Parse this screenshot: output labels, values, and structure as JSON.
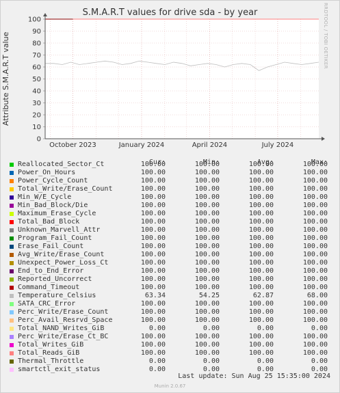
{
  "chart_data": {
    "type": "line",
    "title": "S.M.A.R.T values for drive sda - by year",
    "ylabel": "Attribute S.M.A.R.T value",
    "ylim": [
      0,
      100
    ],
    "yticks": [
      0,
      10,
      20,
      30,
      40,
      50,
      60,
      70,
      80,
      90,
      100
    ],
    "xlim": [
      "2023-08-25",
      "2024-08-25"
    ],
    "xticks": [
      {
        "label": "October 2023",
        "date": "2023-10-01"
      },
      {
        "label": "January 2024",
        "date": "2024-01-01"
      },
      {
        "label": "April 2024",
        "date": "2024-04-01"
      },
      {
        "label": "July 2024",
        "date": "2024-07-01"
      }
    ],
    "grid": true,
    "series": [
      {
        "name": "Reallocated_Sector_Ct",
        "color": "#00cc00",
        "values": [
          100,
          100
        ]
      },
      {
        "name": "Power_On_Hours",
        "color": "#0066b3",
        "values": [
          100,
          100
        ]
      },
      {
        "name": "Power_Cycle_Count",
        "color": "#ff8000",
        "values": [
          100,
          100
        ]
      },
      {
        "name": "Total_Write/Erase_Count",
        "color": "#ffcc00",
        "values": [
          100,
          100
        ]
      },
      {
        "name": "Min_W/E_Cycle",
        "color": "#330099",
        "values": [
          100,
          100
        ]
      },
      {
        "name": "Min_Bad_Block/Die",
        "color": "#990099",
        "values": [
          100,
          100
        ]
      },
      {
        "name": "Maximum_Erase_Cycle",
        "color": "#ccff00",
        "values": [
          100,
          100
        ]
      },
      {
        "name": "Total_Bad_Block",
        "color": "#ff0000",
        "values": [
          100,
          100
        ]
      },
      {
        "name": "Unknown_Marvell_Attr",
        "color": "#808080",
        "values": [
          100,
          100
        ]
      },
      {
        "name": "Program_Fail_Count",
        "color": "#008f00",
        "values": [
          100,
          100
        ]
      },
      {
        "name": "Erase_Fail_Count",
        "color": "#00487d",
        "values": [
          100,
          100
        ]
      },
      {
        "name": "Avg_Write/Erase_Count",
        "color": "#b35a00",
        "values": [
          100,
          100
        ]
      },
      {
        "name": "Unexpect_Power_Loss_Ct",
        "color": "#b38f00",
        "values": [
          100,
          100
        ]
      },
      {
        "name": "End_to_End_Error",
        "color": "#6b006b",
        "values": [
          100,
          100
        ]
      },
      {
        "name": "Reported_Uncorrect",
        "color": "#8fb300",
        "values": [
          100,
          100
        ]
      },
      {
        "name": "Command_Timeout",
        "color": "#b30000",
        "values": [
          100,
          100
        ]
      },
      {
        "name": "Temperature_Celsius",
        "color": "#bebebe",
        "values": [
          63,
          63,
          62,
          64,
          62,
          63,
          64,
          65,
          64,
          62,
          63,
          65,
          64,
          63,
          62,
          64,
          63,
          61,
          62,
          63,
          62,
          60,
          62,
          63,
          62,
          57,
          60,
          62,
          64,
          63,
          62,
          63,
          64
        ]
      },
      {
        "name": "SATA_CRC_Error",
        "color": "#80ff80",
        "values": [
          100,
          100
        ]
      },
      {
        "name": "Perc_Write/Erase_Count",
        "color": "#80c9ff",
        "values": [
          100,
          100
        ]
      },
      {
        "name": "Perc_Avail_Resrvd_Space",
        "color": "#ffc080",
        "values": [
          100,
          100
        ]
      },
      {
        "name": "Total_NAND_Writes_GiB",
        "color": "#ffe680",
        "values": [
          0,
          0
        ]
      },
      {
        "name": "Perc_Write/Erase_Ct_BC",
        "color": "#aa80ff",
        "values": [
          100,
          100
        ]
      },
      {
        "name": "Total_Writes_GiB",
        "color": "#ee00cc",
        "values": [
          100,
          100
        ]
      },
      {
        "name": "Total_Reads_GiB",
        "color": "#ff8080",
        "values": [
          100,
          100
        ]
      },
      {
        "name": "Thermal_Throttle",
        "color": "#666600",
        "values": [
          0,
          0
        ]
      },
      {
        "name": "smartctl_exit_status",
        "color": "#ffbfff",
        "values": [
          0,
          0
        ]
      }
    ]
  },
  "legend": {
    "headers": {
      "cur": "Cur:",
      "min": "Min:",
      "avg": "Avg:",
      "max": "Max:"
    },
    "rows": [
      {
        "name": "Reallocated_Sector_Ct",
        "color": "#00cc00",
        "cur": "100.00",
        "min": "100.00",
        "avg": "100.00",
        "max": "100.00"
      },
      {
        "name": "Power_On_Hours",
        "color": "#0066b3",
        "cur": "100.00",
        "min": "100.00",
        "avg": "100.00",
        "max": "100.00"
      },
      {
        "name": "Power_Cycle_Count",
        "color": "#ff8000",
        "cur": "100.00",
        "min": "100.00",
        "avg": "100.00",
        "max": "100.00"
      },
      {
        "name": "Total_Write/Erase_Count",
        "color": "#ffcc00",
        "cur": "100.00",
        "min": "100.00",
        "avg": "100.00",
        "max": "100.00"
      },
      {
        "name": "Min_W/E_Cycle",
        "color": "#330099",
        "cur": "100.00",
        "min": "100.00",
        "avg": "100.00",
        "max": "100.00"
      },
      {
        "name": "Min_Bad_Block/Die",
        "color": "#990099",
        "cur": "100.00",
        "min": "100.00",
        "avg": "100.00",
        "max": "100.00"
      },
      {
        "name": "Maximum_Erase_Cycle",
        "color": "#ccff00",
        "cur": "100.00",
        "min": "100.00",
        "avg": "100.00",
        "max": "100.00"
      },
      {
        "name": "Total_Bad_Block",
        "color": "#ff0000",
        "cur": "100.00",
        "min": "100.00",
        "avg": "100.00",
        "max": "100.00"
      },
      {
        "name": "Unknown_Marvell_Attr",
        "color": "#808080",
        "cur": "100.00",
        "min": "100.00",
        "avg": "100.00",
        "max": "100.00"
      },
      {
        "name": "Program_Fail_Count",
        "color": "#008f00",
        "cur": "100.00",
        "min": "100.00",
        "avg": "100.00",
        "max": "100.00"
      },
      {
        "name": "Erase_Fail_Count",
        "color": "#00487d",
        "cur": "100.00",
        "min": "100.00",
        "avg": "100.00",
        "max": "100.00"
      },
      {
        "name": "Avg_Write/Erase_Count",
        "color": "#b35a00",
        "cur": "100.00",
        "min": "100.00",
        "avg": "100.00",
        "max": "100.00"
      },
      {
        "name": "Unexpect_Power_Loss_Ct",
        "color": "#b38f00",
        "cur": "100.00",
        "min": "100.00",
        "avg": "100.00",
        "max": "100.00"
      },
      {
        "name": "End_to_End_Error",
        "color": "#6b006b",
        "cur": "100.00",
        "min": "100.00",
        "avg": "100.00",
        "max": "100.00"
      },
      {
        "name": "Reported_Uncorrect",
        "color": "#8fb300",
        "cur": "100.00",
        "min": "100.00",
        "avg": "100.00",
        "max": "100.00"
      },
      {
        "name": "Command_Timeout",
        "color": "#b30000",
        "cur": "100.00",
        "min": "100.00",
        "avg": "100.00",
        "max": "100.00"
      },
      {
        "name": "Temperature_Celsius",
        "color": "#bebebe",
        "cur": "63.34",
        "min": "54.25",
        "avg": "62.87",
        "max": "68.00"
      },
      {
        "name": "SATA_CRC_Error",
        "color": "#80ff80",
        "cur": "100.00",
        "min": "100.00",
        "avg": "100.00",
        "max": "100.00"
      },
      {
        "name": "Perc_Write/Erase_Count",
        "color": "#80c9ff",
        "cur": "100.00",
        "min": "100.00",
        "avg": "100.00",
        "max": "100.00"
      },
      {
        "name": "Perc_Avail_Resrvd_Space",
        "color": "#ffc080",
        "cur": "100.00",
        "min": "100.00",
        "avg": "100.00",
        "max": "100.00"
      },
      {
        "name": "Total_NAND_Writes_GiB",
        "color": "#ffe680",
        "cur": "0.00",
        "min": "0.00",
        "avg": "0.00",
        "max": "0.00"
      },
      {
        "name": "Perc_Write/Erase_Ct_BC",
        "color": "#aa80ff",
        "cur": "100.00",
        "min": "100.00",
        "avg": "100.00",
        "max": "100.00"
      },
      {
        "name": "Total_Writes_GiB",
        "color": "#ee00cc",
        "cur": "100.00",
        "min": "100.00",
        "avg": "100.00",
        "max": "100.00"
      },
      {
        "name": "Total_Reads_GiB",
        "color": "#ff8080",
        "cur": "100.00",
        "min": "100.00",
        "avg": "100.00",
        "max": "100.00"
      },
      {
        "name": "Thermal_Throttle",
        "color": "#666600",
        "cur": "0.00",
        "min": "0.00",
        "avg": "0.00",
        "max": "0.00"
      },
      {
        "name": "smartctl_exit_status",
        "color": "#ffbfff",
        "cur": "0.00",
        "min": "0.00",
        "avg": "0.00",
        "max": "0.00"
      }
    ]
  },
  "last_update": "Last update: Sun Aug 25 15:35:00 2024",
  "watermark": "RRDTOOL / TOBI OETIKER",
  "footer": "Munin 2.0.67"
}
